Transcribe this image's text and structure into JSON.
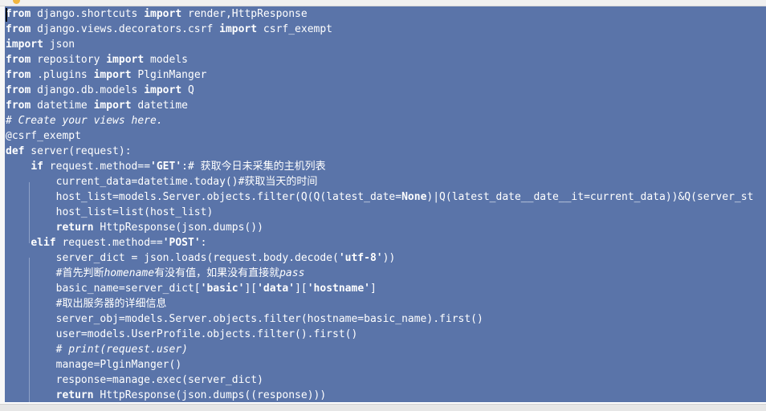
{
  "editor": {
    "selection_color": "#5a74a9",
    "lines": [
      [
        [
          "from",
          "k"
        ],
        [
          " django.shortcuts ",
          "n"
        ],
        [
          "import",
          "k"
        ],
        [
          " render,HttpResponse",
          "n"
        ]
      ],
      [
        [
          "from",
          "k"
        ],
        [
          " django.views.decorators.csrf ",
          "n"
        ],
        [
          "import",
          "k"
        ],
        [
          " csrf_exempt",
          "n"
        ]
      ],
      [
        [
          "import",
          "k"
        ],
        [
          " json",
          "n"
        ]
      ],
      [
        [
          "from",
          "k"
        ],
        [
          " repository ",
          "n"
        ],
        [
          "import",
          "k"
        ],
        [
          " models",
          "n"
        ]
      ],
      [
        [
          "from",
          "k"
        ],
        [
          " .plugins ",
          "n"
        ],
        [
          "import",
          "k"
        ],
        [
          " PlginManger",
          "n"
        ]
      ],
      [
        [
          "from",
          "k"
        ],
        [
          " django.db.models ",
          "n"
        ],
        [
          "import",
          "k"
        ],
        [
          " Q",
          "n"
        ]
      ],
      [
        [
          "from",
          "k"
        ],
        [
          " datetime ",
          "n"
        ],
        [
          "import",
          "k"
        ],
        [
          " datetime",
          "n"
        ]
      ],
      [
        [
          "# Create your views here.",
          "c"
        ]
      ],
      [
        [
          "@csrf_exempt",
          "n"
        ]
      ],
      [
        [
          "def",
          "k"
        ],
        [
          " server(request):",
          "n"
        ]
      ],
      [
        [
          "    ",
          "n"
        ],
        [
          "if",
          "k"
        ],
        [
          " request.method==",
          "n"
        ],
        [
          "'GET'",
          "s"
        ],
        [
          ":# 获取今日未采集的主机列表",
          "n"
        ]
      ],
      [
        [
          "        current_data=datetime.today()#获取当天的时间",
          "n"
        ]
      ],
      [
        [
          "        host_list=models.Server.objects.filter(Q(Q(latest_date=",
          "n"
        ],
        [
          "None",
          "k"
        ],
        [
          ")|Q(latest_date__date__it=current_data))&Q(server_st",
          "n"
        ]
      ],
      [
        [
          "        host_list=list(host_list)",
          "n"
        ]
      ],
      [
        [
          "        ",
          "n"
        ],
        [
          "return",
          "k"
        ],
        [
          " HttpResponse(json.dumps())",
          "n"
        ]
      ],
      [
        [
          "    ",
          "n"
        ],
        [
          "elif",
          "k"
        ],
        [
          " request.method==",
          "n"
        ],
        [
          "'POST'",
          "s"
        ],
        [
          ":",
          "n"
        ]
      ],
      [
        [
          "        server_dict = json.loads(request.body.decode(",
          "n"
        ],
        [
          "'utf-8'",
          "s"
        ],
        [
          "))",
          "n"
        ]
      ],
      [
        [
          "        #首先判断",
          "n"
        ],
        [
          "homename",
          "c"
        ],
        [
          "有没有值，如果没有直接就",
          "n"
        ],
        [
          "pass",
          "c"
        ]
      ],
      [
        [
          "        basic_name=server_dict[",
          "n"
        ],
        [
          "'basic'",
          "s"
        ],
        [
          "][",
          "n"
        ],
        [
          "'data'",
          "s"
        ],
        [
          "][",
          "n"
        ],
        [
          "'hostname'",
          "s"
        ],
        [
          "]",
          "n"
        ]
      ],
      [
        [
          "        #取出服务器的详细信息",
          "n"
        ]
      ],
      [
        [
          "        server_obj=models.Server.objects.filter(hostname=basic_name).first()",
          "n"
        ]
      ],
      [
        [
          "        user=models.UserProfile.objects.filter().first()",
          "n"
        ]
      ],
      [
        [
          "        # print(request.user)",
          "c"
        ]
      ],
      [
        [
          "        manage=PlginManger()",
          "n"
        ]
      ],
      [
        [
          "        response=manage.exec(server_dict)",
          "n"
        ]
      ],
      [
        [
          "        ",
          "n"
        ],
        [
          "return",
          "k"
        ],
        [
          " HttpResponse(json.dumps((response)))",
          "n"
        ]
      ]
    ]
  },
  "icons": {
    "top": "lightbulb-icon"
  }
}
